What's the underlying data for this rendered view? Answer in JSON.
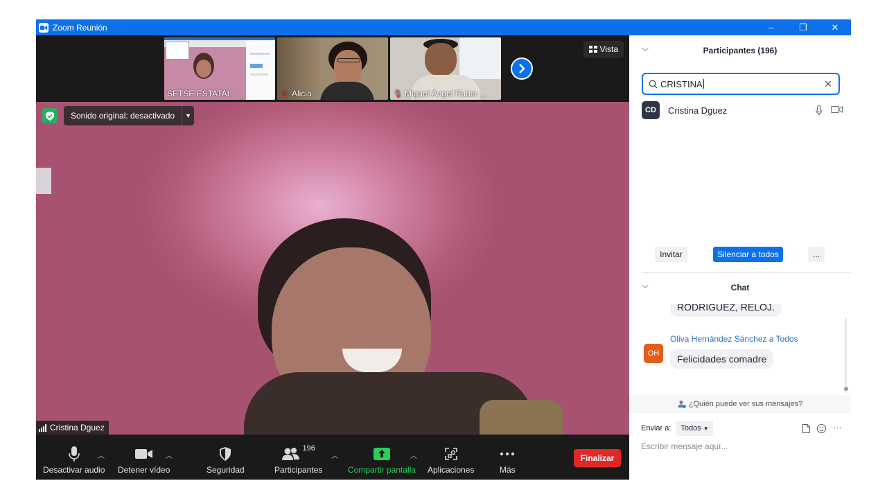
{
  "window": {
    "title": "Zoom Reunión",
    "controls": [
      "–",
      "❐",
      "✕"
    ]
  },
  "strip": {
    "thumbnails": [
      {
        "name": "SETSE ESTATAL",
        "muted": false
      },
      {
        "name": "Alicia",
        "muted": true
      },
      {
        "name": "Miguel Ángel Rubio ...",
        "muted": true
      }
    ],
    "view_label": "Vista"
  },
  "main_video": {
    "sound_label": "Sonido original: desactivado",
    "speaker_name": "Cristina Dguez"
  },
  "toolbar": {
    "audio": "Desactivar audio",
    "video": "Detener vídeo",
    "security": "Seguridad",
    "participants": "Participantes",
    "participants_count": "196",
    "share": "Compartir pantalla",
    "apps": "Aplicaciones",
    "more": "Más",
    "end": "Finalizar"
  },
  "participants_panel": {
    "title": "Participantes (196)",
    "search_value": "CRISTINA",
    "results": [
      {
        "initials": "CD",
        "name": "Cristina Dguez"
      }
    ],
    "invite": "Invitar",
    "mute_all": "Silenciar a todos",
    "more": "..."
  },
  "chat_panel": {
    "title": "Chat",
    "partial_message": "RODRIGUEZ, RELOJ.",
    "sender": "Oliva Hernández Sánchez a Todos",
    "sender_initials": "OH",
    "message": "Felicidades comadre",
    "visibility": "¿Quién puede ver sus mensajes?",
    "send_to_label": "Enviar a:",
    "send_to_value": "Todos",
    "compose_placeholder": "Escribir mensaje aquí..."
  },
  "colors": {
    "zoom_blue": "#0e71eb",
    "end_red": "#e02828",
    "share_green": "#27d05a"
  }
}
